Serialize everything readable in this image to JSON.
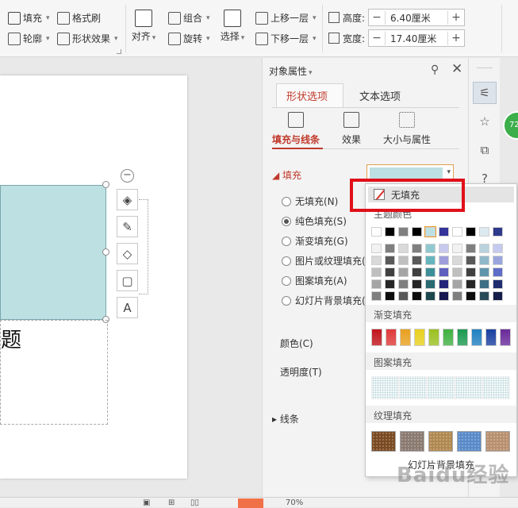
{
  "ribbon": {
    "fill_label": "填充",
    "format_painter_label": "格式刷",
    "outline_label": "轮廓",
    "shape_effect_label": "形状效果",
    "align_label": "对齐",
    "group_label": "组合",
    "rotate_label": "旋转",
    "select_label": "选择",
    "bring_forward_label": "上移一层",
    "send_backward_label": "下移一层",
    "height_label": "高度:",
    "height_value": "6.40厘米",
    "width_label": "宽度:",
    "width_value": "17.40厘米",
    "minus": "−",
    "plus": "+"
  },
  "slide": {
    "title_fragment": "题"
  },
  "panel": {
    "title": "对象属性",
    "tabs": [
      "形状选项",
      "文本选项"
    ],
    "subtabs": [
      "填充与线条",
      "效果",
      "大小与属性"
    ],
    "fill_section": "填充",
    "fill_options": [
      "无填充(N)",
      "纯色填充(S)",
      "渐变填充(G)",
      "图片或纹理填充(",
      "图案填充(A)",
      "幻灯片背景填充("
    ],
    "selected_fill_index": 1,
    "color_label": "颜色(C)",
    "transparency_label": "透明度(T)",
    "line_section": "线条"
  },
  "dropdown": {
    "no_fill": "无填充",
    "theme_colors": "主题颜色",
    "gradient_fill": "渐变填充",
    "pattern_fill": "图案填充",
    "texture_fill": "纹理填充",
    "slide_bg_fill": "幻灯片背景填充"
  },
  "badge": {
    "value": "72"
  },
  "status": {
    "zoom": "70%"
  },
  "watermark": "Baidu经验",
  "colors": {
    "accent_red": "#c0392b",
    "highlight_red": "#e0101a",
    "shape_fill": "#bde0e3",
    "badge_green": "#3cae4a"
  },
  "theme_palette": [
    [
      "#ffffff",
      "#000000",
      "#7f7f7f",
      "#000000",
      "#bde0e3",
      "#34349b",
      "#ffffff",
      "#000000",
      "#dce9ee",
      "#2e3a8a"
    ],
    [
      "#f2f2f2",
      "#7f7f7f",
      "#d9d9d9",
      "#7f7f7f",
      "#8fc9cf",
      "#c9c9ee",
      "#f2f2f2",
      "#7f7f7f",
      "#b8d3de",
      "#c5cbee"
    ],
    [
      "#d9d9d9",
      "#595959",
      "#bfbfbf",
      "#595959",
      "#66b5bd",
      "#9e9edd",
      "#d9d9d9",
      "#595959",
      "#8fb8c8",
      "#9aa5de"
    ],
    [
      "#bfbfbf",
      "#404040",
      "#a5a5a5",
      "#404040",
      "#3c8f98",
      "#5f5fbf",
      "#bfbfbf",
      "#404040",
      "#5f95ac",
      "#5d6cc7"
    ],
    [
      "#a5a5a5",
      "#262626",
      "#7f7f7f",
      "#262626",
      "#2a6a71",
      "#25257a",
      "#a5a5a5",
      "#262626",
      "#3f6f84",
      "#202c70"
    ],
    [
      "#7f7f7f",
      "#0d0d0d",
      "#595959",
      "#0d0d0d",
      "#1c484d",
      "#171750",
      "#7f7f7f",
      "#0d0d0d",
      "#294a59",
      "#151d4a"
    ]
  ],
  "gradient_colors": [
    "#c0141b",
    "#e03a3a",
    "#e8a020",
    "#e8d020",
    "#9ac020",
    "#40b040",
    "#1a9a50",
    "#2080c0",
    "#1a40a0",
    "#6a2a9a"
  ],
  "texture_colors": [
    "#7a4a22",
    "#8a7a70",
    "#b08850",
    "#5a8ac8",
    "#b89070"
  ]
}
